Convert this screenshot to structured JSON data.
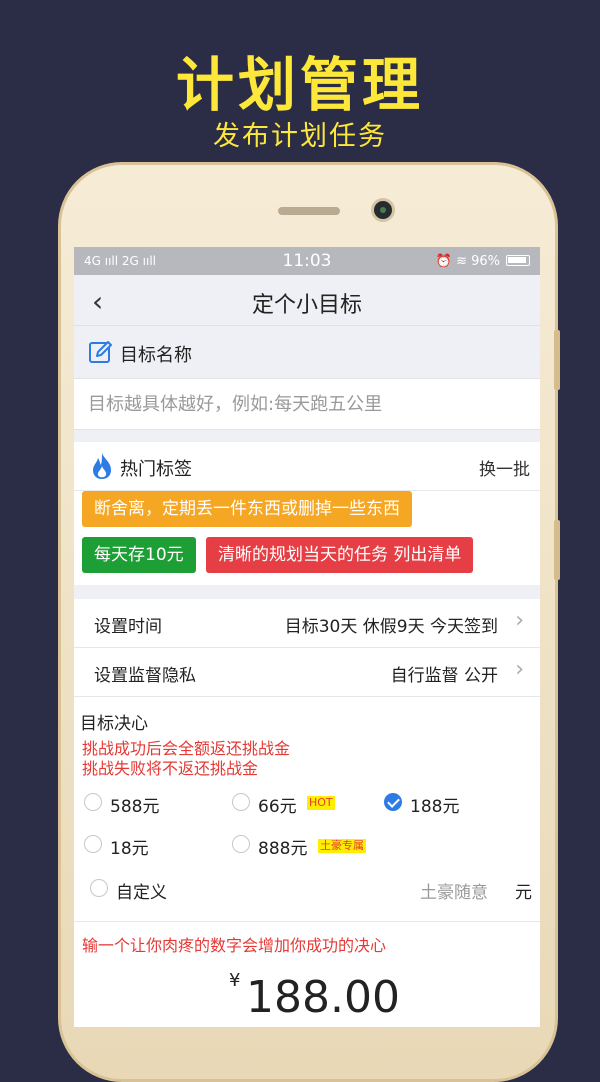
{
  "promo": {
    "title": "计划管理",
    "subtitle": "发布计划任务"
  },
  "statusbar": {
    "left": "4G ııll 2G ııll",
    "time": "11:03",
    "right": "⏰ ≋ 96%"
  },
  "navbar": {
    "back_glyph": "‹",
    "title": "定个小目标"
  },
  "goal_name": {
    "label": "目标名称",
    "placeholder": "目标越具体越好，例如:每天跑五公里",
    "value": ""
  },
  "hot_tags": {
    "label": "热门标签",
    "refresh_label": "换一批",
    "tags": [
      {
        "text": "断舍离，定期丢一件东西或删掉一些东西",
        "color": "#f5a623"
      },
      {
        "text": "每天存10元",
        "color": "#1e9f36"
      },
      {
        "text": "清晰的规划当天的任务 列出清单",
        "color": "#e53e44"
      }
    ]
  },
  "settings": [
    {
      "key": "设置时间",
      "value": "目标30天 休假9天 今天签到"
    },
    {
      "key": "设置监督隐私",
      "value": "自行监督 公开"
    }
  ],
  "resolve": {
    "title": "目标决心",
    "notes": [
      "挑战成功后会全额返还挑战金",
      "挑战失败将不返还挑战金"
    ],
    "options": [
      {
        "label": "588元",
        "checked": false,
        "badge": ""
      },
      {
        "label": "66元",
        "checked": false,
        "badge": "HOT"
      },
      {
        "label": "188元",
        "checked": true,
        "badge": ""
      },
      {
        "label": "18元",
        "checked": false,
        "badge": ""
      },
      {
        "label": "888元",
        "checked": false,
        "badge": "土豪专属"
      }
    ],
    "custom": {
      "label": "自定义",
      "placeholder": "土豪随意",
      "unit": "元"
    }
  },
  "amount": {
    "note": "输一个让你肉疼的数字会增加你成功的决心",
    "currency": "¥",
    "value": "188.00"
  },
  "colors": {
    "background": "#2b2c45",
    "promo_yellow": "#fde83a",
    "accent_blue": "#2d7be5",
    "warning_red": "#e53935"
  }
}
